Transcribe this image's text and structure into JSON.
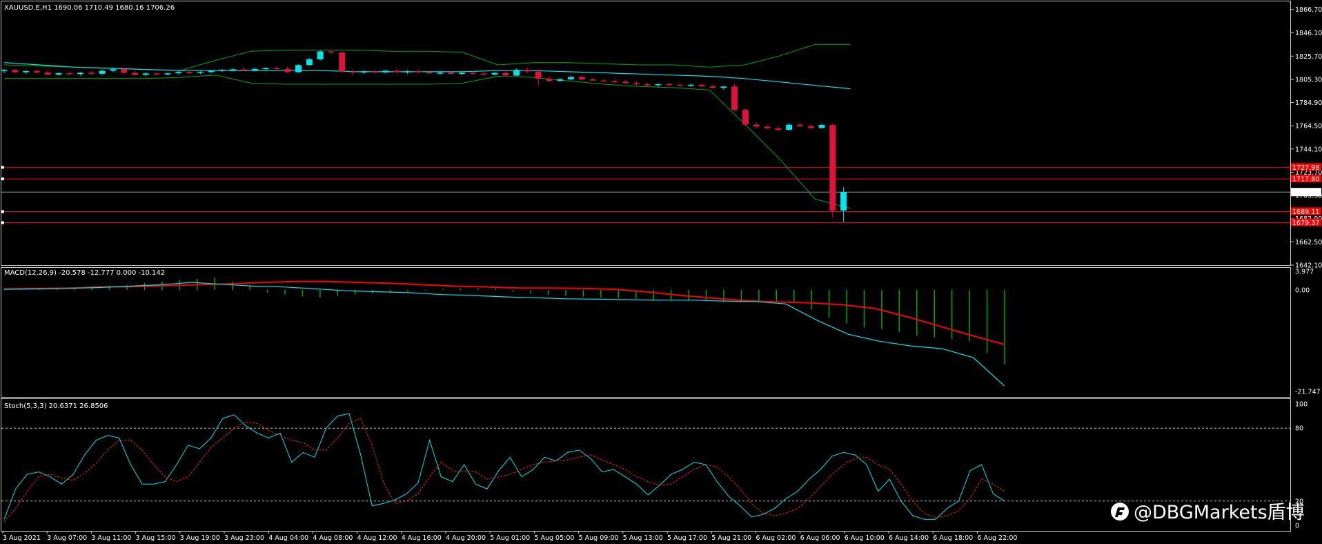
{
  "main_panel": {
    "header": "XAUUSD.E,H1  1690.06 1710.49 1680.16 1706.26",
    "price_ticks": [
      "1866.70",
      "1846.10",
      "1825.70",
      "1805.30",
      "1784.90",
      "1764.50",
      "1744.10",
      "1723.70",
      "1703.30",
      "1682.90",
      "1662.50",
      "1642.10"
    ],
    "current_price_label": "1706.26",
    "hline_labels": [
      "1727.98",
      "1717.80",
      "1689.11",
      "1679.37"
    ]
  },
  "macd_panel": {
    "header": "MACD(12,26,9) -20.578 -12.777 0.000 -10.142",
    "ticks": [
      "3.977",
      "0.00",
      "-21.747"
    ]
  },
  "stoch_panel": {
    "header": "Stoch(5,3,3) 20.6371 26.8506",
    "ticks": [
      "100",
      "80",
      "20",
      "0"
    ]
  },
  "x_axis": {
    "labels": [
      "3 Aug 2021",
      "3 Aug 07:00",
      "3 Aug 11:00",
      "3 Aug 15:00",
      "3 Aug 19:00",
      "3 Aug 23:00",
      "4 Aug 04:00",
      "4 Aug 08:00",
      "4 Aug 12:00",
      "4 Aug 16:00",
      "4 Aug 20:00",
      "5 Aug 01:00",
      "5 Aug 05:00",
      "5 Aug 09:00",
      "5 Aug 13:00",
      "5 Aug 17:00",
      "5 Aug 21:00",
      "6 Aug 02:00",
      "6 Aug 06:00",
      "6 Aug 10:00",
      "6 Aug 14:00",
      "6 Aug 18:00",
      "6 Aug 22:00"
    ]
  },
  "watermark": "@DBGMarkets盾博",
  "colors": {
    "bull": "#00e5ee",
    "bear": "#dc143c",
    "band": "#00aa00",
    "ma": "#00e5ee",
    "hline": "#ff0000",
    "macd_signal": "#ff0000",
    "macd_line": "#00e5ee",
    "macd_hist": "#00aa00",
    "stoch_k": "#00e5ee",
    "stoch_d": "#ff2020"
  },
  "chart_data": [
    {
      "type": "candlestick",
      "title": "XAUUSD.E,H1",
      "timeframe": "H1",
      "last_bar": {
        "open": 1690.06,
        "high": 1710.49,
        "low": 1680.16,
        "close": 1706.26
      },
      "ylim": [
        1642.1,
        1875.0
      ],
      "horizontal_lines": [
        1727.98,
        1717.8,
        1689.11,
        1679.37
      ],
      "current_price_line": 1706.26,
      "bars": [
        [
          1812.5,
          1814.3,
          1810.5,
          1813.5
        ],
        [
          1813.5,
          1814.5,
          1811.0,
          1811.5
        ],
        [
          1811.5,
          1813.2,
          1810.0,
          1812.6
        ],
        [
          1812.6,
          1814.0,
          1810.8,
          1811.3
        ],
        [
          1811.3,
          1812.8,
          1808.8,
          1809.4
        ],
        [
          1809.4,
          1811.6,
          1808.2,
          1810.7
        ],
        [
          1810.7,
          1812.4,
          1809.2,
          1809.9
        ],
        [
          1809.9,
          1811.8,
          1808.6,
          1811.1
        ],
        [
          1811.1,
          1812.6,
          1809.6,
          1810.2
        ],
        [
          1810.2,
          1813.5,
          1809.4,
          1812.8
        ],
        [
          1812.8,
          1815.6,
          1811.5,
          1814.2
        ],
        [
          1814.2,
          1815.3,
          1810.2,
          1811.0
        ],
        [
          1811.0,
          1812.4,
          1808.5,
          1809.2
        ],
        [
          1809.2,
          1811.4,
          1808.0,
          1810.5
        ],
        [
          1810.5,
          1812.0,
          1808.8,
          1809.6
        ],
        [
          1809.6,
          1811.4,
          1808.6,
          1810.6
        ],
        [
          1810.6,
          1812.6,
          1809.6,
          1811.8
        ],
        [
          1811.8,
          1813.0,
          1810.0,
          1810.8
        ],
        [
          1810.8,
          1812.4,
          1809.8,
          1811.7
        ],
        [
          1811.7,
          1813.5,
          1810.9,
          1812.9
        ],
        [
          1812.9,
          1814.5,
          1811.8,
          1813.6
        ],
        [
          1813.6,
          1815.0,
          1812.2,
          1814.1
        ],
        [
          1814.1,
          1816.0,
          1812.8,
          1813.3
        ],
        [
          1813.3,
          1815.4,
          1812.2,
          1814.5
        ],
        [
          1814.5,
          1816.0,
          1813.0,
          1815.2
        ],
        [
          1815.2,
          1817.0,
          1814.0,
          1814.6
        ],
        [
          1814.6,
          1816.6,
          1810.5,
          1811.6
        ],
        [
          1811.6,
          1818.5,
          1811.0,
          1817.8
        ],
        [
          1817.8,
          1823.8,
          1817.2,
          1822.9
        ],
        [
          1822.9,
          1830.5,
          1822.0,
          1829.8
        ],
        [
          1829.8,
          1831.8,
          1827.5,
          1828.9
        ],
        [
          1828.9,
          1829.6,
          1810.5,
          1812.2
        ],
        [
          1812.2,
          1814.0,
          1809.0,
          1811.3
        ],
        [
          1811.3,
          1813.3,
          1810.0,
          1812.4
        ],
        [
          1812.4,
          1813.8,
          1810.6,
          1811.4
        ],
        [
          1811.4,
          1813.6,
          1810.4,
          1812.9
        ],
        [
          1812.9,
          1814.0,
          1810.8,
          1811.6
        ],
        [
          1811.6,
          1813.2,
          1810.3,
          1812.4
        ],
        [
          1812.4,
          1813.6,
          1810.8,
          1811.5
        ],
        [
          1811.5,
          1813.0,
          1809.8,
          1810.6
        ],
        [
          1810.6,
          1812.0,
          1809.2,
          1811.2
        ],
        [
          1811.2,
          1812.6,
          1809.4,
          1810.1
        ],
        [
          1810.1,
          1811.8,
          1808.8,
          1811.1
        ],
        [
          1811.1,
          1812.5,
          1809.6,
          1810.4
        ],
        [
          1810.4,
          1812.0,
          1808.6,
          1809.5
        ],
        [
          1809.5,
          1811.6,
          1808.4,
          1810.9
        ],
        [
          1810.9,
          1812.8,
          1808.0,
          1808.6
        ],
        [
          1808.6,
          1814.8,
          1808.2,
          1813.6
        ],
        [
          1813.6,
          1815.0,
          1811.3,
          1812.2
        ],
        [
          1812.2,
          1813.5,
          1800.0,
          1806.0
        ],
        [
          1806.0,
          1808.2,
          1802.5,
          1804.0
        ],
        [
          1804.0,
          1806.6,
          1802.8,
          1805.3
        ],
        [
          1805.3,
          1808.4,
          1804.5,
          1807.4
        ],
        [
          1807.4,
          1808.2,
          1804.4,
          1805.2
        ],
        [
          1805.2,
          1806.6,
          1803.6,
          1804.2
        ],
        [
          1804.2,
          1805.6,
          1802.6,
          1803.8
        ],
        [
          1803.8,
          1805.2,
          1802.2,
          1803.2
        ],
        [
          1803.2,
          1804.6,
          1801.4,
          1801.9
        ],
        [
          1801.9,
          1803.4,
          1799.8,
          1800.9
        ],
        [
          1800.9,
          1802.4,
          1799.4,
          1800.2
        ],
        [
          1800.2,
          1801.6,
          1798.6,
          1801.1
        ],
        [
          1801.1,
          1802.6,
          1799.6,
          1800.4
        ],
        [
          1800.4,
          1801.8,
          1799.2,
          1799.8
        ],
        [
          1799.8,
          1801.4,
          1798.6,
          1800.5
        ],
        [
          1800.5,
          1801.8,
          1798.6,
          1799.2
        ],
        [
          1799.2,
          1800.6,
          1797.2,
          1797.9
        ],
        [
          1797.9,
          1799.4,
          1796.2,
          1799.0
        ],
        [
          1799.0,
          1801.0,
          1777.0,
          1778.5
        ],
        [
          1778.5,
          1779.6,
          1764.4,
          1765.5
        ],
        [
          1765.5,
          1767.6,
          1762.2,
          1763.8
        ],
        [
          1763.8,
          1765.6,
          1761.4,
          1762.4
        ],
        [
          1762.4,
          1764.0,
          1760.2,
          1760.9
        ],
        [
          1760.9,
          1766.4,
          1760.6,
          1765.4
        ],
        [
          1765.4,
          1767.2,
          1763.2,
          1764.2
        ],
        [
          1764.2,
          1766.0,
          1761.5,
          1762.6
        ],
        [
          1762.6,
          1766.2,
          1762.0,
          1765.2
        ],
        [
          1765.2,
          1766.4,
          1684.0,
          1690.06
        ],
        [
          1690.06,
          1710.49,
          1680.16,
          1706.26
        ]
      ],
      "bollinger": {
        "upper": [
          1818,
          1817,
          1816,
          1815,
          1814,
          1813,
          1822,
          1830,
          1831,
          1831,
          1831,
          1830,
          1830,
          1829,
          1818,
          1820,
          1820,
          1819,
          1818,
          1818,
          1816,
          1818,
          1826,
          1836,
          1836
        ],
        "lower": [
          1806,
          1806,
          1806,
          1806,
          1806,
          1807,
          1809,
          1802,
          1801,
          1801,
          1801,
          1801,
          1801,
          1802,
          1808,
          1807,
          1804,
          1801,
          1799,
          1798,
          1796,
          1766,
          1735,
          1700,
          1692
        ]
      },
      "moving_average": [
        1820,
        1818,
        1816,
        1815,
        1814,
        1813,
        1813,
        1813,
        1813,
        1813,
        1812,
        1812,
        1812,
        1812,
        1813,
        1813,
        1812,
        1811,
        1810,
        1809,
        1808,
        1806,
        1803,
        1800,
        1797
      ]
    },
    {
      "type": "macd",
      "title": "MACD(12,26,9)",
      "params": [
        12,
        26,
        9
      ],
      "ylim": [
        -21.747,
        3.977
      ],
      "histogram": [
        0.1,
        0.2,
        0.2,
        0.3,
        0.6,
        0.7,
        0.9,
        1.1,
        1.5,
        1.8,
        2.1,
        2.4,
        2.6,
        1.8,
        0.8,
        -0.6,
        -1.0,
        -1.4,
        -1.6,
        -1.3,
        -1.0,
        -0.8,
        -0.6,
        -0.4,
        -0.2,
        0.2,
        0.3,
        0.4,
        0.3,
        -0.4,
        -0.8,
        -1.1,
        -1.3,
        -1.5,
        -1.6,
        -1.8,
        -1.9,
        -2.1,
        -2.2,
        -2.3,
        -2.3,
        -2.4,
        -2.4,
        -2.5,
        -2.5,
        -2.6,
        -4.2,
        -6.0,
        -7.2,
        -8.0,
        -8.4,
        -9.0,
        -9.8,
        -10.2,
        -10.5,
        -11.0,
        -13.5,
        -16.0
      ],
      "signal": [
        0.2,
        0.3,
        0.4,
        0.6,
        0.7,
        0.9,
        1.1,
        1.3,
        1.6,
        1.8,
        1.8,
        1.6,
        1.4,
        1.1,
        0.8,
        0.6,
        0.4,
        0.4,
        0.3,
        0.1,
        -0.5,
        -1.2,
        -1.8,
        -2.3,
        -2.6,
        -2.8,
        -3.2,
        -4.0,
        -5.8,
        -7.8,
        -9.8,
        -11.7
      ],
      "macd": [
        0.1,
        0.2,
        0.3,
        0.5,
        0.8,
        1.1,
        1.6,
        1.2,
        0.8,
        0.6,
        0.2,
        -0.2,
        -0.4,
        -0.6,
        -1.0,
        -1.2,
        -1.5,
        -1.7,
        -1.9,
        -2.0,
        -2.1,
        -2.2,
        -2.2,
        -2.4,
        -2.5,
        -3.0,
        -6.5,
        -9.5,
        -11.0,
        -12.0,
        -12.6,
        -14.5,
        -20.6
      ]
    },
    {
      "type": "stochastic",
      "title": "Stoch(5,3,3)",
      "params": [
        5,
        3,
        3
      ],
      "ylim": [
        0,
        100
      ],
      "levels": [
        80,
        20
      ],
      "k": [
        5,
        30,
        42,
        44,
        40,
        34,
        42,
        58,
        70,
        74,
        72,
        50,
        34,
        34,
        36,
        50,
        66,
        63,
        72,
        88,
        91,
        82,
        76,
        72,
        76,
        52,
        60,
        56,
        80,
        90,
        92,
        58,
        16,
        18,
        21,
        26,
        35,
        70,
        40,
        36,
        50,
        34,
        30,
        45,
        56,
        40,
        46,
        56,
        53,
        60,
        62,
        55,
        44,
        46,
        40,
        34,
        25,
        33,
        42,
        46,
        52,
        50,
        36,
        24,
        16,
        7,
        9,
        14,
        22,
        28,
        38,
        46,
        57,
        60,
        58,
        50,
        28,
        38,
        20,
        8,
        5,
        5,
        14,
        20,
        45,
        50,
        26,
        20
      ],
      "d": [
        3,
        14,
        28,
        40,
        42,
        39,
        37,
        43,
        51,
        62,
        70,
        70,
        62,
        50,
        40,
        36,
        40,
        52,
        64,
        72,
        80,
        85,
        84,
        78,
        74,
        70,
        68,
        62,
        62,
        72,
        84,
        88,
        66,
        35,
        18,
        20,
        26,
        40,
        52,
        45,
        44,
        44,
        38,
        40,
        42,
        46,
        50,
        52,
        53,
        54,
        56,
        58,
        54,
        50,
        46,
        40,
        36,
        33,
        34,
        40,
        46,
        50,
        48,
        40,
        30,
        18,
        10,
        8,
        10,
        14,
        22,
        32,
        42,
        50,
        55,
        56,
        50,
        46,
        34,
        20,
        10,
        6,
        8,
        12,
        22,
        38,
        34,
        28
      ]
    }
  ]
}
